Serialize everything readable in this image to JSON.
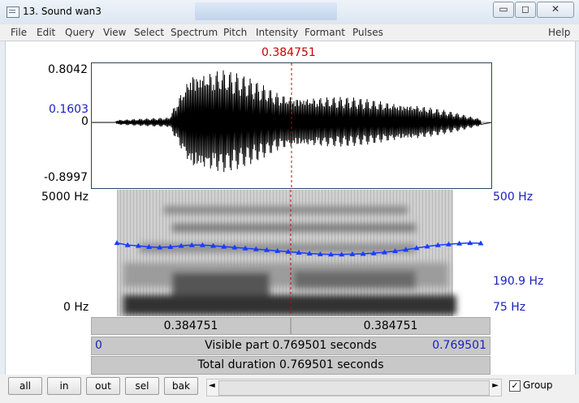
{
  "window": {
    "title": "13. Sound wan3",
    "controls": {
      "minimize": "▭",
      "maximize": "◻",
      "close": "✕"
    }
  },
  "menu": [
    "File",
    "Edit",
    "Query",
    "View",
    "Select",
    "Spectrum",
    "Pitch",
    "Intensity",
    "Formant",
    "Pulses",
    "Help"
  ],
  "cursor": {
    "time_label": "0.384751"
  },
  "waveform": {
    "max_label": "0.8042",
    "cursor_value_label": "0.1603",
    "zero_label": "0",
    "min_label": "-0.8997"
  },
  "spectrogram": {
    "top_freq_label": "5000 Hz",
    "bottom_freq_label": "0 Hz"
  },
  "pitch_axis": {
    "top_label": "500 Hz",
    "cursor_label": "190.9 Hz",
    "bottom_label": "75 Hz"
  },
  "pitch_contour": [
    230,
    222,
    219,
    215,
    213,
    215,
    219,
    222,
    222,
    219,
    216,
    213,
    210,
    207,
    204,
    201,
    198,
    195,
    192,
    190,
    189,
    189,
    190,
    191,
    193,
    196,
    200,
    205,
    211,
    217,
    222,
    225,
    228,
    230,
    229
  ],
  "time_bars": {
    "left_segment": "0.384751",
    "right_segment": "0.384751",
    "visible_start": "0",
    "visible_text": "Visible part 0.769501 seconds",
    "visible_end": "0.769501",
    "total_text": "Total duration 0.769501 seconds"
  },
  "buttons": {
    "all": "all",
    "in": "in",
    "out": "out",
    "sel": "sel",
    "bak": "bak"
  },
  "scroll": {
    "left_arrow": "◄",
    "right_arrow": "►"
  },
  "group": {
    "label": "Group",
    "checked_mark": "✓"
  },
  "colors": {
    "pitch": "#1a3cff",
    "cursor": "#cc0000",
    "axis_blue": "#1a1fbf"
  }
}
